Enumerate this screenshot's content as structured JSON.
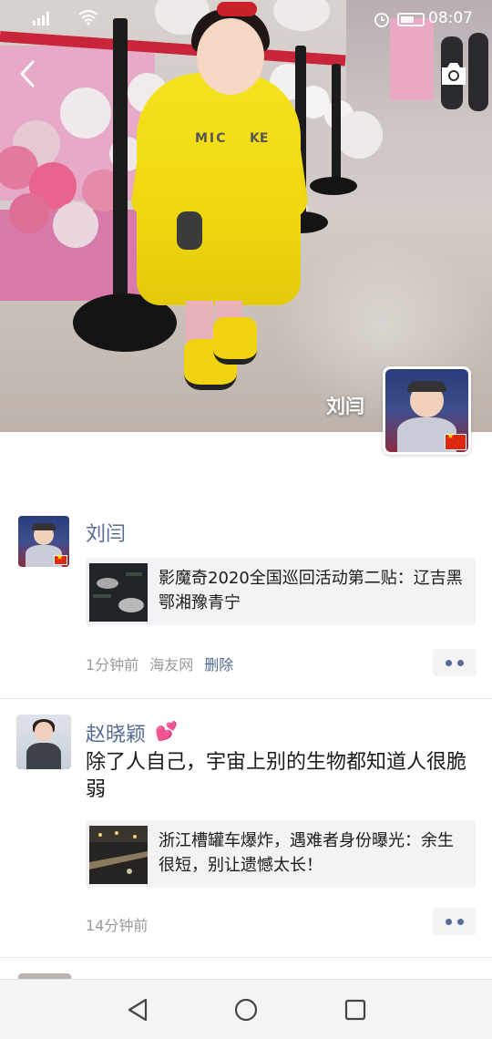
{
  "status_bar": {
    "time": "08:07"
  },
  "profile": {
    "name": "刘闫"
  },
  "posts": [
    {
      "author": "刘闫",
      "link_title": "影魔奇2020全国巡回活动第二贴：辽吉黑鄂湘豫青宁",
      "time": "1分钟前",
      "source": "海友网",
      "delete_label": "删除"
    },
    {
      "author": "赵晓颖",
      "text": "除了人自己，宇宙上别的生物都知道人很脆弱",
      "link_title": "浙江槽罐车爆炸，遇难者身份曝光：余生很短，别让遗憾太长！",
      "time": "14分钟前"
    }
  ],
  "colors": {
    "name_link": "#576b95",
    "meta_gray": "#9a9a9a",
    "card_bg": "#f3f3f5",
    "heart": "#f061b3"
  },
  "icons": [
    "back-icon",
    "camera-icon",
    "signal-icon",
    "wifi-icon",
    "alarm-icon",
    "battery-icon",
    "more-dots-icon",
    "nav-back-icon",
    "nav-home-icon",
    "nav-recents-icon"
  ]
}
